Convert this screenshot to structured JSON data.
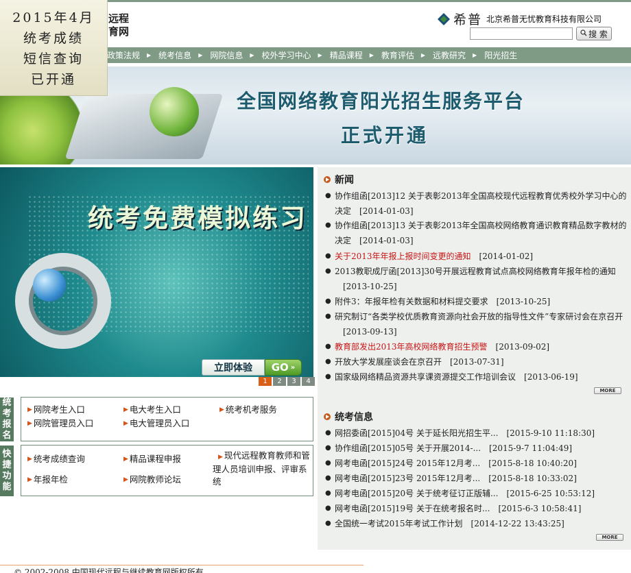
{
  "header": {
    "site_title_line1": "远程",
    "site_title_line2": "育网",
    "brand_name": "希普",
    "brand_company": "北京希普无忧教育科技有限公司",
    "search_placeholder": "",
    "search_button": "搜 索"
  },
  "popup": {
    "lines": [
      "2015年4月",
      "统考成绩",
      "短信查询",
      "已开通"
    ]
  },
  "nav": {
    "items": [
      "政策法规",
      "统考信息",
      "网院信息",
      "校外学习中心",
      "精品课程",
      "教育评估",
      "远教研究",
      "阳光招生"
    ]
  },
  "banner": {
    "title": "全国网络教育阳光招生服务平台",
    "subtitle": "正式开通"
  },
  "promo": {
    "title": "统考免费模拟练习",
    "button": "立即体验",
    "go": "GO",
    "pages": [
      "1",
      "2",
      "3",
      "4"
    ],
    "active_page": "1"
  },
  "tongkao_baoming": {
    "side_label": [
      "统",
      "考",
      "报",
      "名"
    ],
    "links": [
      "网院考生入口",
      "电大考生入口",
      "统考机考服务",
      "网院管理员入口",
      "电大管理员入口"
    ]
  },
  "kuaijie": {
    "side_label": [
      "快",
      "捷",
      "功",
      "能"
    ],
    "links": [
      "统考成绩查询",
      "精品课程申报",
      "现代远程教育教师和管理人员培训申报、评审系统",
      "年报年检",
      "网院教师论坛"
    ]
  },
  "news": {
    "title": "新闻",
    "items": [
      {
        "text": "协作组函[2013]12 关于表彰2013年全国高校现代远程教育优秀校外学习中心的决定",
        "date": "[2014-01-03]"
      },
      {
        "text": "协作组函[2013]13 关于表彰2013年全国高校网络教育通识教育精品数字教材的决定",
        "date": "[2014-01-03]"
      },
      {
        "text": "关于2013年年报上报时间变更的通知",
        "date": "[2014-01-02]"
      },
      {
        "text": "2013教职成厅函[2013]30号开展远程教育试点高校网络教育年报年检的通知",
        "date": "[2013-10-25]"
      },
      {
        "text": "附件3：年报年检有关数据和材料提交要求",
        "date": "[2013-10-25]"
      },
      {
        "text": "研究制订“各类学校优质教育资源向社会开放的指导性文件”专家研讨会在京召开",
        "date": "[2013-09-13]"
      },
      {
        "text": "教育部发出2013年高校网络教育招生预警",
        "date": "[2013-09-02]"
      },
      {
        "text": "开放大学发展座谈会在京召开",
        "date": "[2013-07-31]"
      },
      {
        "text": "国家级网络精品资源共享课资源提交工作培训会议",
        "date": "[2013-06-19]"
      }
    ],
    "more": "MORE"
  },
  "tongkao": {
    "title": "统考信息",
    "items": [
      {
        "text": "网招委函[2015]04号  关于延长阳光招生平...",
        "date": "[2015-9-10 11:18:30]"
      },
      {
        "text": "协作组函[2015]05号  关于开展2014-...",
        "date": "[2015-9-7 11:04:49]"
      },
      {
        "text": "网考电函[2015]24号  2015年12月考...",
        "date": "[2015-8-18 10:40:20]"
      },
      {
        "text": "网考电函[2015]23号  2015年12月考...",
        "date": "[2015-8-18 10:33:02]"
      },
      {
        "text": "网考电函[2015]20号  关于统考征订正版辅...",
        "date": "[2015-6-25 10:53:12]"
      },
      {
        "text": "网考电函[2015]19号  关于在统考报名时...",
        "date": "[2015-6-3 10:58:41]"
      },
      {
        "text": "全国统一考试2015年考试工作计划",
        "date": "[2014-12-22 13:43:25]"
      }
    ],
    "more": "MORE"
  },
  "footer": {
    "text": "© 2002-2008 中国现代远程与继续教育网版权所有"
  },
  "colors": {
    "nav_bg": "#7f9b86",
    "accent": "#d4541a",
    "highlight_red": "#c81414",
    "panel_bg": "#eef0ee"
  }
}
